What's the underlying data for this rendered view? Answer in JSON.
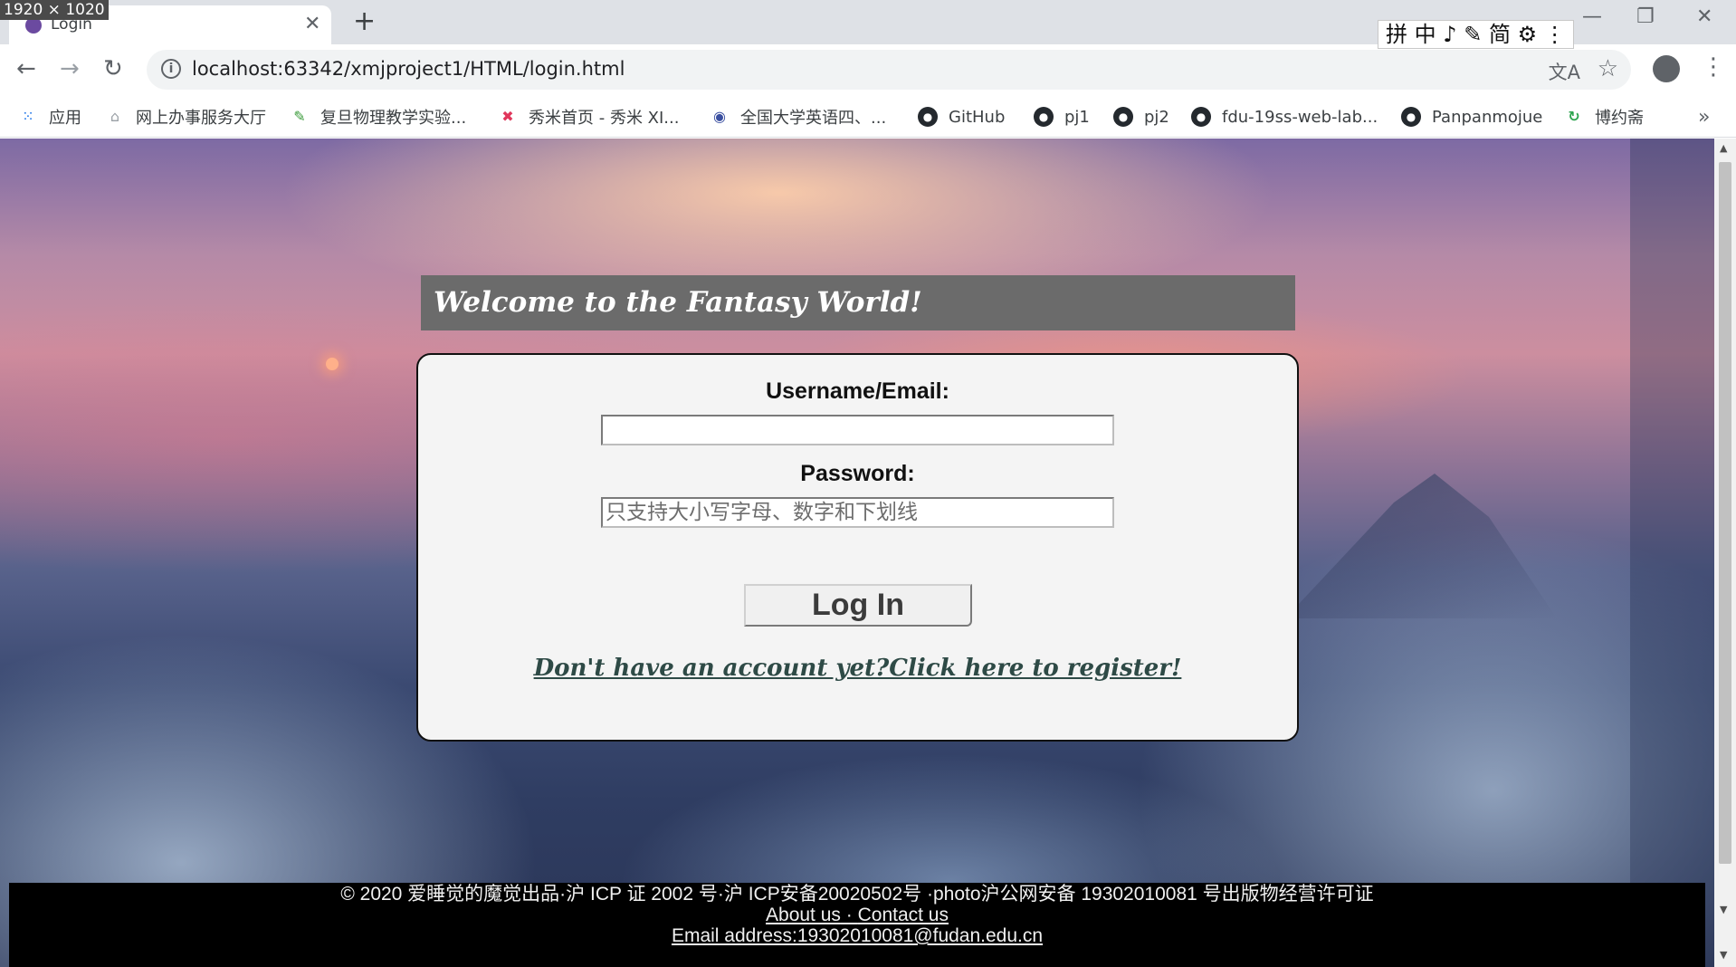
{
  "screenshot_badge": "1920 × 1020",
  "browser": {
    "tab_title": "Login",
    "url": "localhost:63342/xmjproject1/HTML/login.html",
    "ime_bar": "拼 中 ♪ ✎ 简 ⚙ ⋮",
    "bookmarks": [
      {
        "label": "应用",
        "icon": "apps-grid-icon"
      },
      {
        "label": "网上办事服务大厅",
        "icon": "home-icon"
      },
      {
        "label": "复旦物理教学实验...",
        "icon": "book-icon"
      },
      {
        "label": "秀米首页 - 秀米 XI...",
        "icon": "xiumi-icon"
      },
      {
        "label": "全国大学英语四、...",
        "icon": "globe-icon"
      },
      {
        "label": "GitHub",
        "icon": "github-icon"
      },
      {
        "label": "pj1",
        "icon": "github-icon"
      },
      {
        "label": "pj2",
        "icon": "github-icon"
      },
      {
        "label": "fdu-19ss-web-lab...",
        "icon": "github-icon"
      },
      {
        "label": "Panpanmojue",
        "icon": "github-icon"
      },
      {
        "label": "博约斋",
        "icon": "refresh-green-icon"
      }
    ],
    "bookmarks_more": "»"
  },
  "page": {
    "welcome_title": "Welcome to the Fantasy World!",
    "username_label": "Username/Email:",
    "username_value": "",
    "password_label": "Password:",
    "password_placeholder": "只支持大小写字母、数字和下划线",
    "login_button": "Log In",
    "register_link": "Don't have an account yet?Click here to register!"
  },
  "footer": {
    "copyright": "© 2020 爱睡觉的魔觉出品·沪 ICP 证 2002 号·沪 ICP安备20020502号 ·photo沪公网安备 19302010081 号出版物经营许可证",
    "about_link": "About us",
    "separator": " · ",
    "contact_link": "Contact us",
    "email_line": "Email address:19302010081@fudan.edu.cn"
  },
  "colors": {
    "welcome_bg": "#6b6b6b",
    "card_bg": "#f4f4f4",
    "footer_bg": "#000000",
    "register_link": "#2e4a46"
  }
}
